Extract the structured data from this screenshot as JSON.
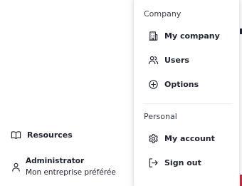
{
  "sidebar": {
    "resources_label": "Resources",
    "resources_icon": "book-open-icon",
    "user": {
      "name": "Administrator",
      "company": "Mon entreprise préférée",
      "icon": "user-icon"
    }
  },
  "menu": {
    "company_section_label": "Company",
    "personal_section_label": "Personal",
    "items": [
      {
        "label": "My company",
        "icon": "building-icon"
      },
      {
        "label": "Users",
        "icon": "users-icon"
      },
      {
        "label": "Options",
        "icon": "plus-circle-icon"
      },
      {
        "label": "My account",
        "icon": "gear-icon"
      },
      {
        "label": "Sign out",
        "icon": "sign-out-icon"
      }
    ]
  },
  "colors": {
    "text": "#1f2330",
    "menu_background": "#ffffff",
    "accent_edge": "#c6283a"
  }
}
